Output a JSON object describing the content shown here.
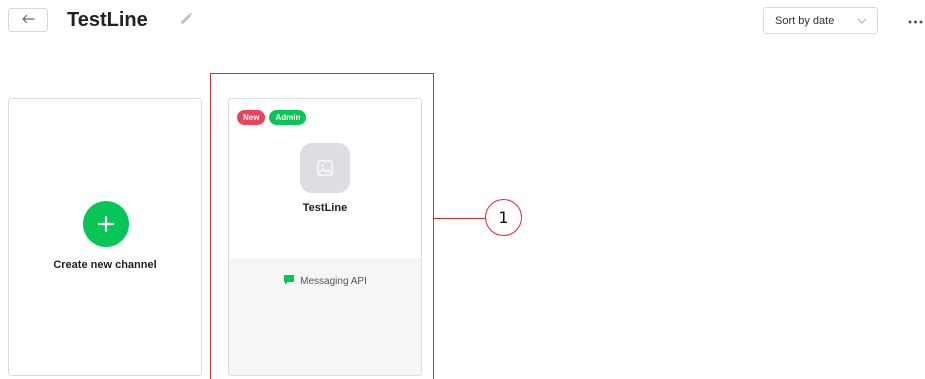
{
  "header": {
    "back_icon": "arrow-left-icon",
    "title": "TestLine",
    "edit_icon": "pencil-icon",
    "sort": {
      "selected": "Sort by date",
      "icon": "chevron-down-icon"
    },
    "more_icon": "more-horizontal-icon"
  },
  "create_card": {
    "icon": "plus-icon",
    "label": "Create new channel",
    "accent": "#06c755"
  },
  "channels": [
    {
      "badges": [
        {
          "label": "New",
          "color": "#f0405a"
        },
        {
          "label": "Admin",
          "color": "#06c755"
        }
      ],
      "avatar_icon": "image-placeholder-icon",
      "name": "TestLine",
      "type_icon": "chat-bubble-icon",
      "type": "Messaging API"
    }
  ],
  "annotation": {
    "number": "1",
    "color": "#e5282e"
  }
}
